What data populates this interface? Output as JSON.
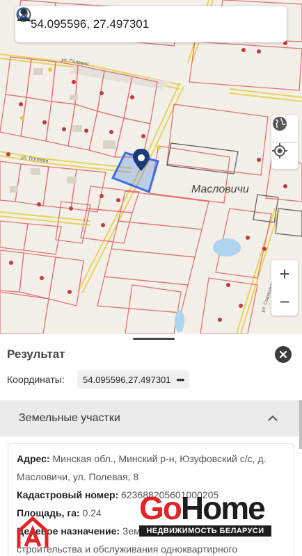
{
  "search": {
    "value": "54.095596, 27.497301",
    "clear_icon": "clear-circle-icon",
    "search_icon": "search-icon",
    "profile_icon": "person-icon"
  },
  "map": {
    "place_name": "Масловичи",
    "street_name_1": "ул. Полевая",
    "street_name_2": "ул. Полевая",
    "street_name_3": "ул. Совхозная",
    "controls": {
      "layers_icon": "globe-icon",
      "locate_icon": "my-location-icon",
      "zoom_in": "+",
      "zoom_out": "−"
    },
    "colors": {
      "parcel_border": "#e06666",
      "selected_parcel": "#3b6fe0",
      "road": "#e8d75a",
      "water": "#aed4f0"
    }
  },
  "result_panel": {
    "title": "Результат",
    "coords_label": "Координаты:",
    "coords_value": "54.095596,27.497301",
    "coords_menu": "•••",
    "section_title": "Земельные участки",
    "fields": {
      "address_label": "Адрес:",
      "address_value": "Минская обл., Минский р-н, Юзуфовский с/с, д. Масловичи, ул. Полевая, 8",
      "cadastral_label": "Кадастровый номер:",
      "cadastral_value": "623688205601000205",
      "area_label": "Площадь, га:",
      "area_value": "0.24",
      "purpose_label": "Целевое назначение:",
      "purpose_value": "Земельный участок для строительства и обслуживания одноквартирного"
    }
  },
  "watermark": {
    "logo_go": "Go",
    "logo_home": "Home",
    "logo_subtitle": "НЕДВИЖИМОСТЬ БЕЛАРУСИ"
  }
}
